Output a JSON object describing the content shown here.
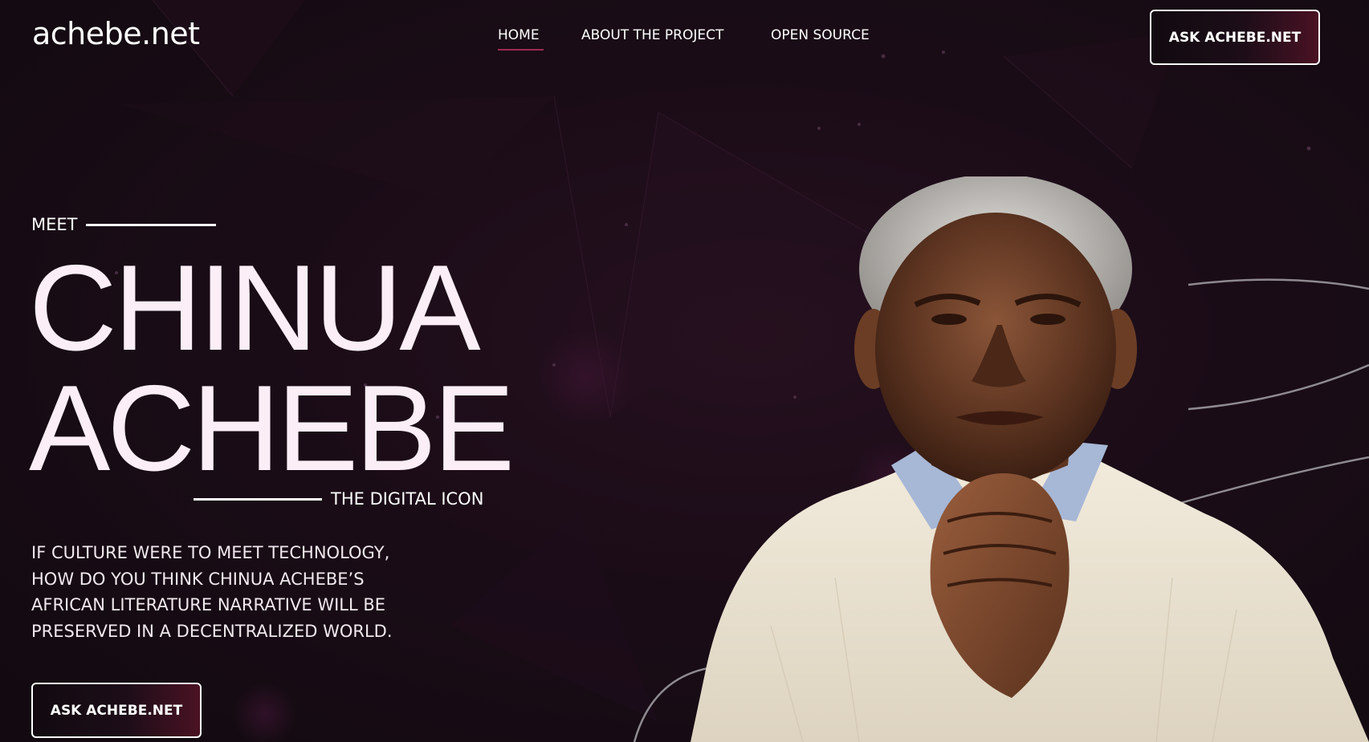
{
  "header": {
    "logo": "achebe.net",
    "nav": [
      {
        "label": "HOME",
        "active": true
      },
      {
        "label": "ABOUT THE PROJECT",
        "active": false
      },
      {
        "label": "OPEN SOURCE",
        "active": false
      }
    ],
    "cta_label": "ASK ACHEBE.NET"
  },
  "hero": {
    "eyebrow": "MEET",
    "name_line1": "CHINUA",
    "name_line2": "ACHEBE",
    "subtitle": "THE DIGITAL ICON",
    "tagline_lines": [
      "IF CULTURE WERE TO MEET TECHNOLOGY,",
      "HOW DO YOU THINK CHINUA ACHEBE’S",
      "AFRICAN LITERATURE NARRATIVE WILL BE",
      "PRESERVED IN A DECENTRALIZED WORLD."
    ],
    "cta_label": "ASK ACHEBE.NET"
  },
  "colors": {
    "background": "#1a0c17",
    "accent": "#9c2a52",
    "heading": "#fbeef6"
  }
}
